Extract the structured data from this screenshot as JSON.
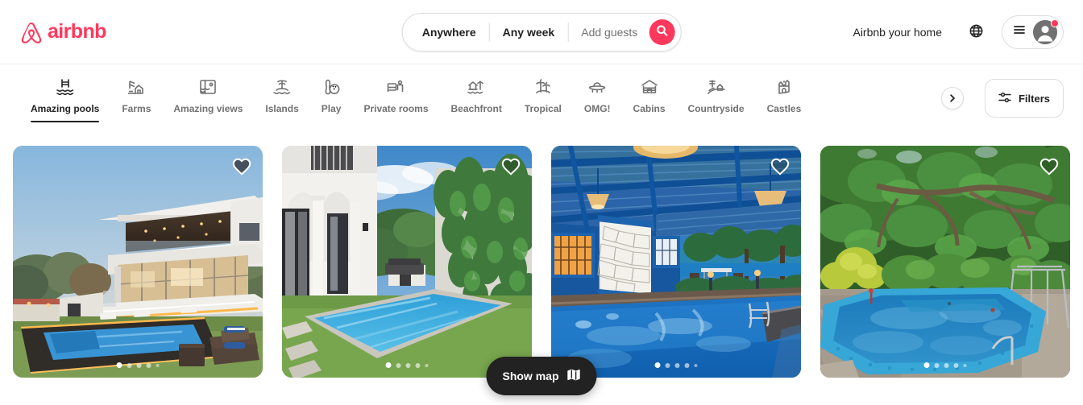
{
  "brand": {
    "name": "airbnb",
    "color": "#FF385C",
    "logo_icon": "airbnb-belo-icon"
  },
  "search": {
    "location": "Anywhere",
    "dates": "Any week",
    "guests_placeholder": "Add guests",
    "search_icon": "search-icon"
  },
  "header": {
    "host_link": "Airbnb your home",
    "globe_icon": "globe-icon",
    "menu_icon": "hamburger-menu-icon",
    "avatar_icon": "user-avatar-icon",
    "notification_color": "#FF385C"
  },
  "categories": [
    {
      "label": "Amazing pools",
      "icon": "pool-icon",
      "active": true
    },
    {
      "label": "Farms",
      "icon": "farm-icon",
      "active": false
    },
    {
      "label": "Amazing views",
      "icon": "view-icon",
      "active": false
    },
    {
      "label": "Islands",
      "icon": "island-icon",
      "active": false
    },
    {
      "label": "Play",
      "icon": "bowling-icon",
      "active": false
    },
    {
      "label": "Private rooms",
      "icon": "bed-icon",
      "active": false
    },
    {
      "label": "Beachfront",
      "icon": "beach-hut-icon",
      "active": false
    },
    {
      "label": "Tropical",
      "icon": "palm-tree-icon",
      "active": false
    },
    {
      "label": "OMG!",
      "icon": "ufo-icon",
      "active": false
    },
    {
      "label": "Cabins",
      "icon": "cabin-icon",
      "active": false
    },
    {
      "label": "Countryside",
      "icon": "countryside-icon",
      "active": false
    },
    {
      "label": "Castles",
      "icon": "castle-icon",
      "active": false
    }
  ],
  "nav": {
    "next_icon": "chevron-right-icon"
  },
  "filters": {
    "label": "Filters",
    "icon": "sliders-icon"
  },
  "listings": [
    {
      "image_alt": "Modern white villa at dusk with lap pool and lawn loungers",
      "heart_icon": "heart-icon",
      "heart_filled": true,
      "photo_count": 5,
      "active_photo": 1
    },
    {
      "image_alt": "Long rectangular blue pool beside white colonial house with ivy wall",
      "heart_icon": "heart-icon",
      "heart_filled": false,
      "photo_count": 5,
      "active_photo": 1
    },
    {
      "image_alt": "Covered pool under blue pergola with hanging pendant lights",
      "heart_icon": "heart-icon",
      "heart_filled": false,
      "photo_count": 5,
      "active_photo": 1
    },
    {
      "image_alt": "Octagonal mosaic tiled pool surrounded by large green trees",
      "heart_icon": "heart-icon",
      "heart_filled": false,
      "photo_count": 5,
      "active_photo": 1
    }
  ],
  "map_toggle": {
    "label": "Show map",
    "icon": "map-icon"
  }
}
